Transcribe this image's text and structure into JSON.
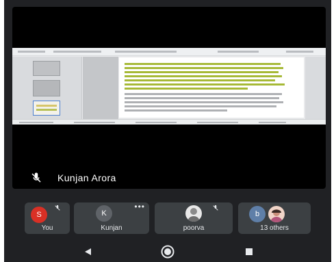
{
  "presenter": {
    "name": "Kunjan Arora",
    "mic_icon": "mic-off-icon"
  },
  "participants": [
    {
      "name": "You",
      "initial": "S",
      "avatar_color": "#d93025",
      "muted": true
    },
    {
      "name": "Kunjan",
      "initial": "K",
      "avatar_color": "#5f6368",
      "more_menu": true
    },
    {
      "name": "poorva",
      "initial": "",
      "avatar_color": "#dadce0",
      "muted": true
    },
    {
      "name": "13 others",
      "initial": "b",
      "avatar_color": "#5f7fa8"
    }
  ],
  "nav": {
    "back_icon": "back-triangle-icon",
    "home_icon": "home-circle-icon",
    "recents_icon": "recents-square-icon"
  },
  "colors": {
    "background": "#202124",
    "tile": "#3c4043",
    "highlight": "#a6b936"
  }
}
